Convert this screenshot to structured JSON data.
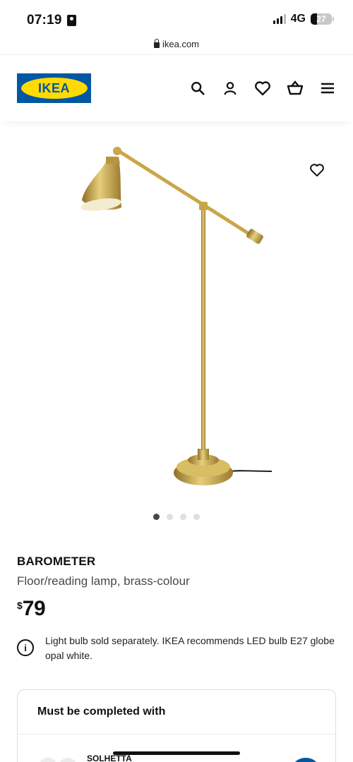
{
  "status_bar": {
    "time": "07:19",
    "network": "4G",
    "battery": "27"
  },
  "browser": {
    "url": "ikea.com"
  },
  "header": {
    "logo_text": "IKEA",
    "icons": [
      "search-icon",
      "account-icon",
      "heart-icon",
      "basket-icon",
      "menu-icon"
    ]
  },
  "gallery": {
    "image_count": 4,
    "active_index": 0
  },
  "product": {
    "name": "BAROMETER",
    "description": "Floor/reading lamp, brass-colour",
    "currency": "$",
    "price": "79"
  },
  "notice": {
    "text": "Light bulb sold separately. IKEA recommends LED bulb E27 globe opal white."
  },
  "complete_with": {
    "title": "Must be completed with",
    "item_name": "SOLHETTA"
  },
  "colors": {
    "brand_blue": "#0058a3",
    "brand_yellow": "#ffdb00",
    "brass": "#c9a648"
  }
}
